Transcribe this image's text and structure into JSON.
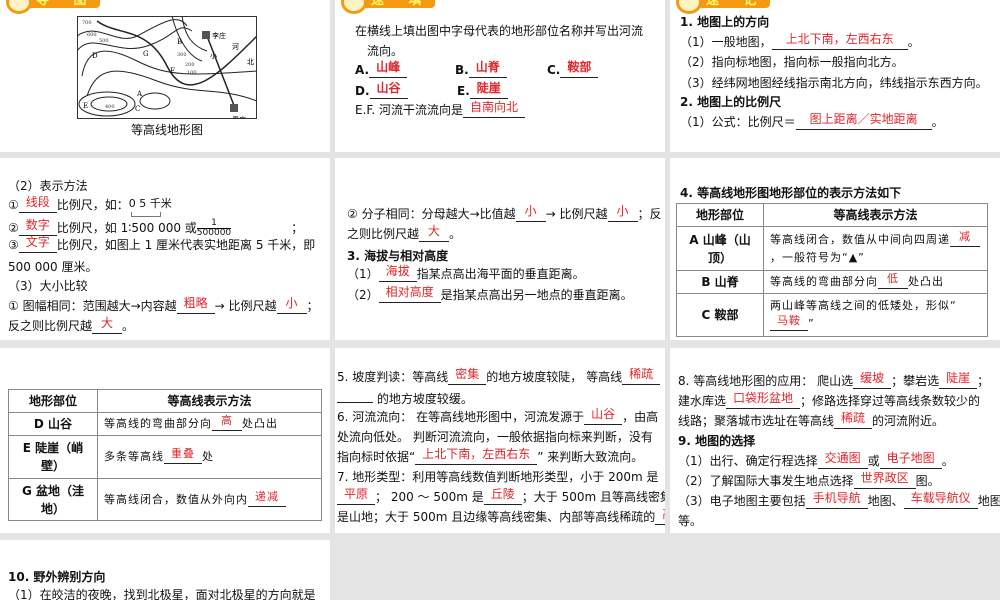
{
  "p1": {
    "badge": "导 图",
    "caption": "等高线地形图",
    "map_labels": {
      "A": "A",
      "B": "B",
      "C": "C",
      "D": "D",
      "E": "E",
      "F": "F",
      "G": "G",
      "village1": "李庄",
      "village2": "周庄",
      "river1": "小",
      "river2": "河",
      "north": "北"
    },
    "contours": [
      "600",
      "500",
      "400",
      "300",
      "200",
      "100",
      "700"
    ]
  },
  "p2": {
    "badge": "速 填",
    "lines": [
      [
        "在横线上填出图中字母代表的地形部位名称并写出河流"
      ],
      [
        "流向。"
      ],
      [
        "A.",
        {
          "a": "山峰"
        }
      ],
      [
        "B.",
        {
          "a": "山脊"
        }
      ],
      [
        "C.",
        {
          "a": "鞍部"
        }
      ],
      [
        "D.",
        {
          "a": "山谷"
        }
      ],
      [
        "E.",
        {
          "a": "陡崖"
        }
      ],
      [
        "E.F. 河流干流流向是",
        {
          "a": "自南向北"
        }
      ]
    ]
  },
  "p3": {
    "badge": "速 记",
    "lines": [
      [
        "1. 地图上的方向"
      ],
      [
        "（1）一般地图，",
        {
          "a": "上北下南，左西右东"
        },
        "。"
      ],
      [
        "（2）指向标地图，指向标一般指向北方。"
      ],
      [
        "（3）经纬网地图经线指示南北方向，纬线指示东西方向。"
      ],
      [
        "2. 地图上的比例尺"
      ],
      [
        "（1）公式：比例尺＝",
        {
          "a": "图上距离／实地距离"
        },
        "。"
      ]
    ]
  },
  "p4": {
    "lines": [
      [
        "（2）表示方法"
      ],
      [
        "①",
        {
          "a": "线段"
        },
        "比例尺，如："
      ],
      [
        "②",
        {
          "a": "数字"
        },
        "比例尺，如 1∶500 000 或"
      ],
      [
        "③",
        {
          "a": "文字"
        },
        "比例尺，如图上 1 厘米代表实地距离 5 千米，即"
      ],
      [
        "500 000 厘米。"
      ],
      [
        "（3）大小比较"
      ],
      [
        "① 图幅相同：范围越大→内容越",
        {
          "a": "粗略"
        },
        "→ 比例尺越",
        {
          "a": "小"
        },
        "；"
      ],
      [
        "反之则比例尺越",
        {
          "a": "大"
        },
        "。"
      ]
    ],
    "scale_label": "0 5 千米",
    "fraction": {
      "num": "1",
      "den": "500000"
    },
    "semicolon": "；"
  },
  "p5": {
    "lines": [
      [
        "② 分子相同：分母越大→比值越",
        {
          "a": "小"
        },
        "→ 比例尺越",
        {
          "a": "小"
        },
        "；反"
      ],
      [
        "之则比例尺越",
        {
          "a": "大"
        },
        "。"
      ],
      [
        "3. 海拔与相对高度"
      ],
      [
        "（1）",
        {
          "a": "海拔"
        },
        "指某点高出海平面的垂直距离。"
      ],
      [
        "（2）",
        {
          "a": "相对高度"
        },
        "是指某点高出另一地点的垂直距离。"
      ]
    ]
  },
  "p6": {
    "title": "4. 等高线地形图地形部位的表示方法如下",
    "headers": [
      "地形部位",
      "等高线表示方法"
    ],
    "rows": [
      {
        "k": "A 山峰（山顶）",
        "v": [
          "等高线闭合，数值从中间向四周递",
          {
            "a": "减"
          },
          "，一般符号为“▲”"
        ]
      },
      {
        "k": "B 山脊",
        "v": [
          "等高线的弯曲部分向",
          {
            "a": "低"
          },
          "处凸出"
        ]
      },
      {
        "k": "C 鞍部",
        "v": [
          "两山峰等高线之间的低矮处，形似“",
          {
            "a": "马鞍"
          },
          "”"
        ]
      }
    ]
  },
  "p7": {
    "headers": [
      "地形部位",
      "等高线表示方法"
    ],
    "rows": [
      {
        "k": "D 山谷",
        "v": [
          "等高线的弯曲部分向",
          {
            "a": "高"
          },
          "处凸出"
        ]
      },
      {
        "k": "E 陡崖（峭壁）",
        "v": [
          "多条等高线",
          {
            "a": "重叠"
          },
          "处"
        ]
      },
      {
        "k": "G 盆地（洼地）",
        "v": [
          "等高线闭合，数值从外向内",
          {
            "a": "递减"
          }
        ]
      }
    ]
  },
  "p8": {
    "lines": [
      [
        "5. 坡度判读：等高线",
        {
          "a": "密集"
        },
        "的地方坡度较陡，  等高线",
        {
          "a": "稀疏"
        }
      ],
      [
        "的地方坡度较缓。"
      ],
      [
        "6. 河流流向：  在等高线地形图中，河流发源于",
        {
          "a": "山谷"
        },
        "，由高"
      ],
      [
        "处流向低处。 判断河流流向，一般依据指向标来判断，没有"
      ],
      [
        "指向标时依据“",
        {
          "a": "上北下南，左西右东"
        },
        "” 来判断大致流向。"
      ],
      [
        "7. 地形类型：利用等高线数值判断地形类型，小于 200m 是"
      ],
      [
        {
          "a": "平原"
        },
        "；  200 ～ 500m 是",
        {
          "a": "丘陵"
        },
        "；大于 500m 且等高线密集的"
      ],
      [
        "是山地；大于 500m 且边缘等高线密集、内部等高线稀疏的",
        {
          "a": "高原"
        }
      ]
    ]
  },
  "p9": {
    "lines": [
      [
        "8. 等高线地形图的应用：  爬山选",
        {
          "a": "缓坡"
        },
        "；攀岩选",
        {
          "a": "陡崖"
        },
        "；"
      ],
      [
        "建水库选",
        {
          "a": "口袋形盆地"
        },
        "；修路选择穿过等高线条数较少的"
      ],
      [
        "线路；聚落城市选址在等高线",
        {
          "a": "稀疏"
        },
        "的河流附近。"
      ],
      [
        "9. 地图的选择"
      ],
      [
        "（1）出行、确定行程选择",
        {
          "a": "交通图"
        },
        "或",
        {
          "a": "电子地图"
        },
        "。"
      ],
      [
        "（2）了解国际大事发生地点选择",
        {
          "a": "世界政区"
        },
        "图。"
      ],
      [
        "（3）电子地图主要包括",
        {
          "a": "手机导航"
        },
        "地图、",
        {
          "a": "车载导航仪"
        },
        "地图"
      ],
      [
        "等。"
      ]
    ]
  },
  "p10": {
    "lines": [
      [
        "10. 野外辨别方向"
      ],
      [
        "（1）在皎洁的夜晚，找到北极星，面对北极星的方向就是"
      ]
    ]
  }
}
